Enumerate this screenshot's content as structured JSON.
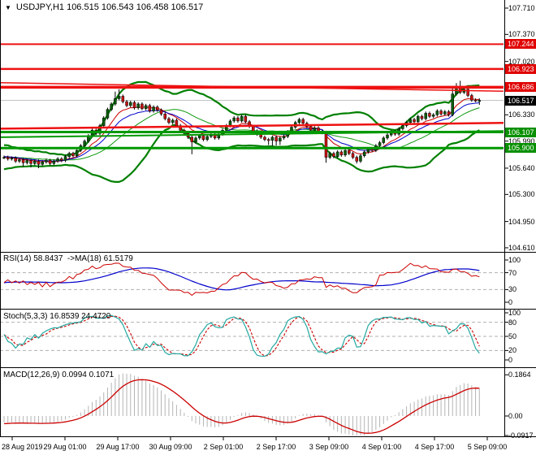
{
  "header": {
    "marker": "▼",
    "title": "USDJPY,H1 106.515 106.543 106.458 106.517"
  },
  "panes": {
    "rsi_label": "RSI(14) 58.8437  ->MA(18) 61.5179",
    "stoch_label": "Stoch(5,3,3) 16.8539 24.4720",
    "macd_label": "MACD(12,26,9) 0.0994 0.1071"
  },
  "colors": {
    "bull": "#0b5e0b",
    "bear": "#cc1111",
    "wick": "#000000",
    "bb": "#008000",
    "bb_mid": "#119911",
    "ma_fast": "#cc0000",
    "ma_slow": "#0000cc",
    "res": "#ee1111",
    "sup": "#009900",
    "price_line": "#c4c4c4",
    "rsi": "#cc0000",
    "rsi_ma": "#0000cc",
    "stoch_k": "#23a8a0",
    "stoch_d": "#cc0000",
    "macd_hist": "#b4b4b4",
    "macd_sig": "#cc0000",
    "dash_level": "#b0b0b0",
    "border": "#000000",
    "badge_red": "#e00000",
    "badge_green": "#089000",
    "badge_black": "#000000"
  },
  "chart_data": {
    "type": "candlestick+indicators",
    "symbol": "USDJPY",
    "timeframe": "H1",
    "ohlc_current": {
      "open": 106.515,
      "high": 106.543,
      "low": 106.458,
      "close": 106.517
    },
    "current_price": 106.517,
    "price_axis_labels": [
      "107.710",
      "107.370",
      "107.020",
      "106.330",
      "105.990",
      "105.640",
      "105.300",
      "104.950",
      "104.610"
    ],
    "price_axis_badges": [
      {
        "text": "107.244",
        "color": "red"
      },
      {
        "text": "106.923",
        "color": "red"
      },
      {
        "text": "106.686",
        "color": "red"
      },
      {
        "text": "106.517",
        "color": "black"
      },
      {
        "text": "106.107",
        "color": "green"
      },
      {
        "text": "105.900",
        "color": "green"
      }
    ],
    "time_axis": [
      "28 Aug 2019",
      "29 Aug 01:00",
      "29 Aug 17:00",
      "30 Aug 09:00",
      "2 Sep 01:00",
      "2 Sep 17:00",
      "3 Sep 09:00",
      "4 Sep 01:00",
      "4 Sep 17:00",
      "5 Sep 09:00"
    ],
    "levels": {
      "resistance": [
        {
          "price": 107.244,
          "w": 2
        },
        {
          "price": 106.923,
          "w": 2.5
        },
        {
          "price": 106.686,
          "w": 3.5
        }
      ],
      "support": [
        {
          "price": 106.107,
          "w": 3
        },
        {
          "price": 105.9,
          "w": 3
        }
      ],
      "trend": [
        {
          "p1": 106.745,
          "p2": 106.635,
          "w": 1.5,
          "c": "res"
        },
        {
          "p1": 106.15,
          "p2": 106.225,
          "w": 2.5,
          "c": "res"
        },
        {
          "p1": 106.04,
          "p2": 106.12,
          "w": 2,
          "c": "sup"
        }
      ]
    },
    "indicators": {
      "bollinger": {
        "period": 20,
        "deviation": 2
      },
      "ma_fast_period": 8,
      "ma_slow_period": 13,
      "rsi": {
        "period": 14,
        "ma_period": 18,
        "value": 58.8437,
        "ma_value": 61.5179,
        "levels": [
          70,
          30
        ],
        "axis": [
          {
            "t": "100",
            "v": 100
          },
          {
            "t": "70",
            "v": 70
          },
          {
            "t": "30",
            "v": 30
          },
          {
            "t": "0",
            "v": 0
          }
        ]
      },
      "stoch": {
        "params": "5,3,3",
        "k": 16.8539,
        "d": 24.472,
        "levels": [
          80,
          50,
          20
        ],
        "axis": [
          {
            "t": "100",
            "v": 100
          },
          {
            "t": "80",
            "v": 80
          },
          {
            "t": "50",
            "v": 50
          },
          {
            "t": "20",
            "v": 20
          },
          {
            "t": "0",
            "v": 0
          }
        ]
      },
      "macd": {
        "params": "12,26,9",
        "macd": 0.0994,
        "signal": 0.1071,
        "axis": [
          {
            "t": "0.1864",
            "v": 0.1864
          },
          {
            "t": "0.00",
            "v": 0
          },
          {
            "t": "-0.0917",
            "v": -0.0917
          }
        ]
      }
    },
    "pre_closes": [
      105.95,
      105.68,
      105.92,
      105.66,
      105.9,
      105.7,
      105.88,
      105.68,
      105.86,
      105.72,
      105.84,
      105.7,
      105.86,
      105.74,
      105.82,
      105.72,
      105.84,
      105.76,
      105.8,
      105.78
    ],
    "closes": [
      105.78,
      105.76,
      105.77,
      105.73,
      105.75,
      105.71,
      105.74,
      105.7,
      105.73,
      105.69,
      105.72,
      105.74,
      105.7,
      105.73,
      105.76,
      105.74,
      105.79,
      105.83,
      105.8,
      105.87,
      105.93,
      105.99,
      106.06,
      106.13,
      106.09,
      106.19,
      106.29,
      106.4,
      106.47,
      106.54,
      106.57,
      106.5,
      106.45,
      106.49,
      106.42,
      106.47,
      106.41,
      106.45,
      106.38,
      106.43,
      106.39,
      106.34,
      106.28,
      106.23,
      106.26,
      106.19,
      106.13,
      106.09,
      106.04,
      105.98,
      106.03,
      106.06,
      106.01,
      106.05,
      106.07,
      106.03,
      106.08,
      106.13,
      106.19,
      106.25,
      106.29,
      106.25,
      106.31,
      106.24,
      106.18,
      106.12,
      106.08,
      106.04,
      106.01,
      106.0,
      106.04,
      105.99,
      106.03,
      106.05,
      106.11,
      106.17,
      106.23,
      106.27,
      106.22,
      106.18,
      106.13,
      106.16,
      106.11,
      106.1,
      105.78,
      105.83,
      105.79,
      105.85,
      105.81,
      105.87,
      105.83,
      105.78,
      105.73,
      105.8,
      105.85,
      105.89,
      105.87,
      105.93,
      105.97,
      106.03,
      106.07,
      106.11,
      106.08,
      106.15,
      106.19,
      106.23,
      106.27,
      106.24,
      106.31,
      106.28,
      106.35,
      106.31,
      106.33,
      106.38,
      106.34,
      106.37,
      106.33,
      106.6,
      106.68,
      106.62,
      106.66,
      106.58,
      106.52,
      106.515,
      106.517
    ],
    "overrides": {
      "5": {
        "l": 105.66
      },
      "7": {
        "l": 105.65
      },
      "9": {
        "l": 105.64
      },
      "29": {
        "h": 106.63
      },
      "30": {
        "h": 106.66
      },
      "49": {
        "l": 105.82
      },
      "69": {
        "l": 105.94
      },
      "70": {
        "l": 105.93
      },
      "71": {
        "l": 105.93
      },
      "72": {
        "l": 105.94
      },
      "84": {
        "h": 106.12,
        "l": 105.71
      },
      "92": {
        "l": 105.7
      },
      "117": {
        "h": 106.69,
        "l": 106.31
      },
      "118": {
        "h": 106.74
      },
      "119": {
        "h": 106.77
      },
      "124": {
        "o": 106.515,
        "h": 106.543,
        "l": 106.458,
        "c": 106.517
      }
    }
  }
}
